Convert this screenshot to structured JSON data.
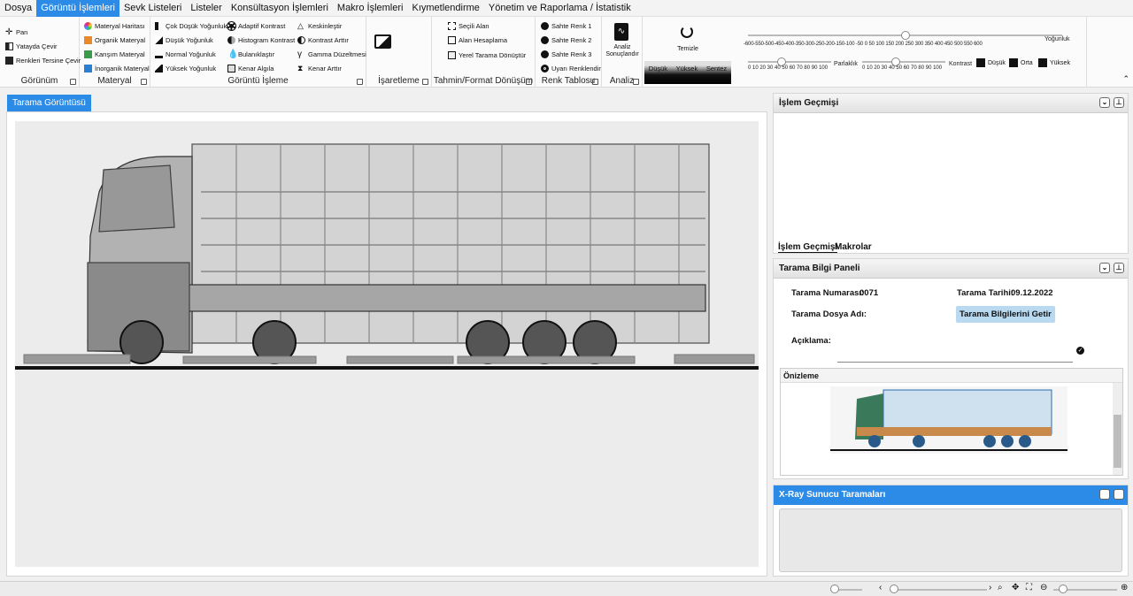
{
  "menu": [
    "Dosya",
    "Görüntü İşlemleri",
    "Sevk Listeleri",
    "Listeler",
    "Konsültasyon İşlemleri",
    "Makro İşlemleri",
    "Kıymetlendirme",
    "Yönetim ve Raporlama / İstatistik"
  ],
  "ribbon": {
    "gorunum": {
      "label": "Görünüm",
      "pan": "Pan",
      "flip": "Yatayda Çevir",
      "invert": "Renkleri Tersine Çevir"
    },
    "materyal": {
      "label": "Materyal",
      "map": "Materyal Haritası",
      "organic": "Organik Materyal",
      "mixed": "Karışım Materyal",
      "inorganic": "İnorganik Materyal"
    },
    "goruntu": {
      "label": "Görüntü İşleme",
      "c1": [
        "Çok Düşük Yoğunluk",
        "Düşük Yoğunluk",
        "Normal Yoğunluk",
        "Yüksek Yoğunluk"
      ],
      "c2": [
        "Adaptif Kontrast",
        "Histogram Kontrast",
        "Bulanıklaştır",
        "Kenar Algıla"
      ],
      "c3": [
        "Keskinleştir",
        "Kontrast Arttır",
        "Gamma Düzeltmesi",
        "Kenar Arttır"
      ]
    },
    "isaret": {
      "label": "İşaretleme"
    },
    "tahmin": {
      "label": "Tahmin/Format Dönüşüm",
      "sel": "Seçili Alan",
      "calc": "Alan Hesaplama",
      "local": "Yerel Tarama Dönüştür"
    },
    "renk": {
      "label": "Renk Tablosu",
      "r1": "Sahte Renk 1",
      "r2": "Sahte Renk 2",
      "r3": "Sahte Renk 3",
      "warn": "Uyarı Renklendir"
    },
    "analiz": {
      "label": "Analiz",
      "btn": "Analiz Sonuçlandır"
    },
    "temizle": {
      "label": "Temizle",
      "tabs": [
        "Düşük",
        "Yüksek",
        "Sentez"
      ]
    },
    "sliders": {
      "density_label": "Yoğunluk",
      "density_ticks": "-600-550-500-450-400-350-300-250-200-150-100 -50  0   50  100 150 200 250 300 350 400  450  500  550  600",
      "bright_label": "Parlaklık",
      "contrast_label": "Kontrast",
      "pct_ticks": "0  10  20  30  40  50  60  70  80  90  100",
      "opts": [
        "Düşük",
        "Orta",
        "Yüksek"
      ],
      "density_value": 0,
      "bright_value": 40,
      "contrast_value": 40
    }
  },
  "scan_tab": "Tarama Görüntüsü",
  "history": {
    "title": "İşlem Geçmişi",
    "tabs": [
      "İşlem Geçmişi",
      "Makrolar"
    ]
  },
  "info": {
    "title": "Tarama Bilgi Paneli",
    "num_label": "Tarama Numarası:",
    "num": "0071",
    "date_label": "Tarama Tarihi:",
    "date": "09.12.2022",
    "file_label": "Tarama Dosya Adı:",
    "fetch": "Tarama Bilgilerini Getir",
    "desc_label": "Açıklama:",
    "preview": "Önizleme"
  },
  "xray": {
    "title": "X-Ray Sunucu Taramaları"
  },
  "colors": {
    "accent": "#2b8be6",
    "fetch_bg": "#b8d9f0"
  }
}
